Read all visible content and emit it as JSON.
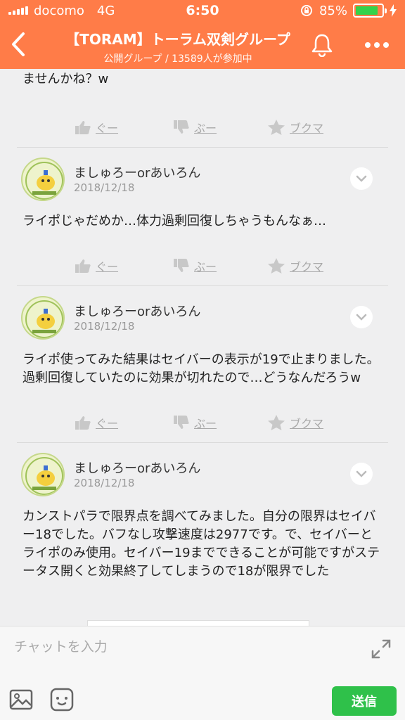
{
  "status": {
    "carrier": "docomo",
    "network": "4G",
    "time": "6:50",
    "battery": "85%",
    "battery_level": 0.85
  },
  "header": {
    "title": "【TORAM】トーラム双剣グループ",
    "subtitle": "公開グループ / 13589人が参加中"
  },
  "actions": {
    "like": "ぐー",
    "dislike": "ぶー",
    "bookmark": "ブクマ"
  },
  "messages": [
    {
      "text": "ませんかね？w"
    },
    {
      "name": "ましゅろーorあいろん",
      "date": "2018/12/18",
      "text": "ライポじゃだめか…体力過剰回復しちゃうもんなぁ…"
    },
    {
      "name": "ましゅろーorあいろん",
      "date": "2018/12/18",
      "text": "ライポ使ってみた結果はセイバーの表示が19で止まりました。過剰回復していたのに効果が切れたので…どうなんだろうw"
    },
    {
      "name": "ましゅろーorあいろん",
      "date": "2018/12/18",
      "text": "カンストパラで限界点を調べてみました。自分の限界はセイバー18でした。バフなし攻撃速度は2977です。で、セイバーとライポのみ使用。セイバー19までできることが可能ですがステータス開くと効果終了してしまうので18が限界でした"
    }
  ],
  "composer": {
    "placeholder": "チャットを入力",
    "send_label": "送信"
  },
  "colors": {
    "header": "#ff7c48",
    "send": "#2fc14a",
    "battery": "#33d24b"
  }
}
